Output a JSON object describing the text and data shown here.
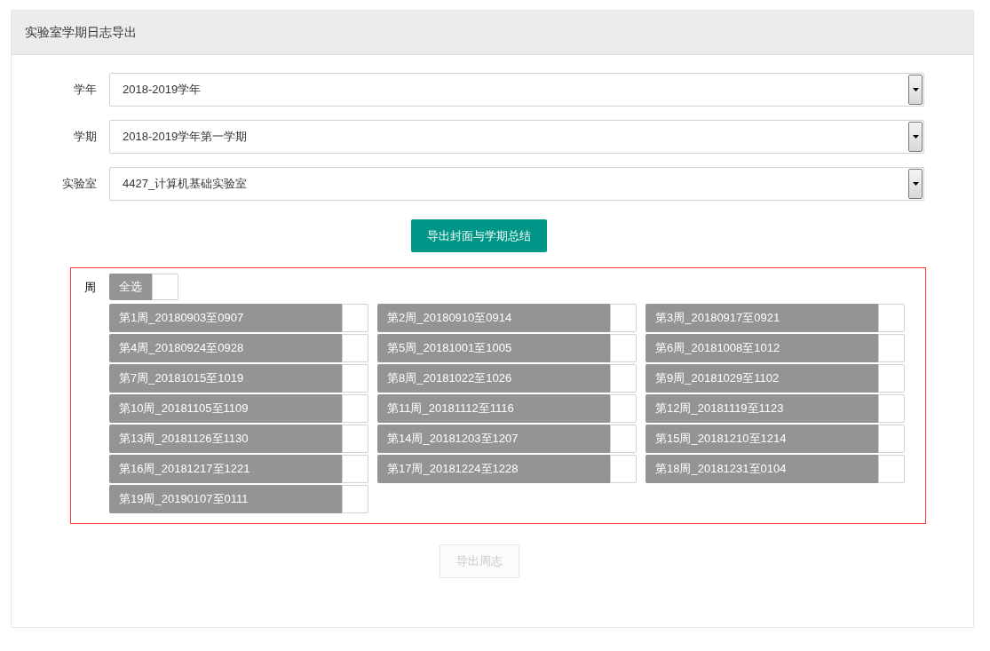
{
  "panel": {
    "title": "实验室学期日志导出"
  },
  "fields": [
    {
      "label": "学年",
      "value": "2018-2019学年"
    },
    {
      "label": "学期",
      "value": "2018-2019学年第一学期"
    },
    {
      "label": "实验室",
      "value": "4427_计算机基础实验室"
    }
  ],
  "export_cover_button": {
    "label": "导出封面与学期总结"
  },
  "weeks": {
    "label": "周",
    "select_all": {
      "label": "全选",
      "checked": false
    },
    "items": [
      {
        "label": "第1周_20180903至0907",
        "checked": false
      },
      {
        "label": "第2周_20180910至0914",
        "checked": false
      },
      {
        "label": "第3周_20180917至0921",
        "checked": false
      },
      {
        "label": "第4周_20180924至0928",
        "checked": false
      },
      {
        "label": "第5周_20181001至1005",
        "checked": false
      },
      {
        "label": "第6周_20181008至1012",
        "checked": false
      },
      {
        "label": "第7周_20181015至1019",
        "checked": false
      },
      {
        "label": "第8周_20181022至1026",
        "checked": false
      },
      {
        "label": "第9周_20181029至1102",
        "checked": false
      },
      {
        "label": "第10周_20181105至1109",
        "checked": false
      },
      {
        "label": "第11周_20181112至1116",
        "checked": false
      },
      {
        "label": "第12周_20181119至1123",
        "checked": false
      },
      {
        "label": "第13周_20181126至1130",
        "checked": false
      },
      {
        "label": "第14周_20181203至1207",
        "checked": false
      },
      {
        "label": "第15周_20181210至1214",
        "checked": false
      },
      {
        "label": "第16周_20181217至1221",
        "checked": false
      },
      {
        "label": "第17周_20181224至1228",
        "checked": false
      },
      {
        "label": "第18周_20181231至0104",
        "checked": false
      },
      {
        "label": "第19周_20190107至0111",
        "checked": false
      }
    ]
  },
  "export_week_button": {
    "label": "导出周志",
    "disabled": true
  }
}
